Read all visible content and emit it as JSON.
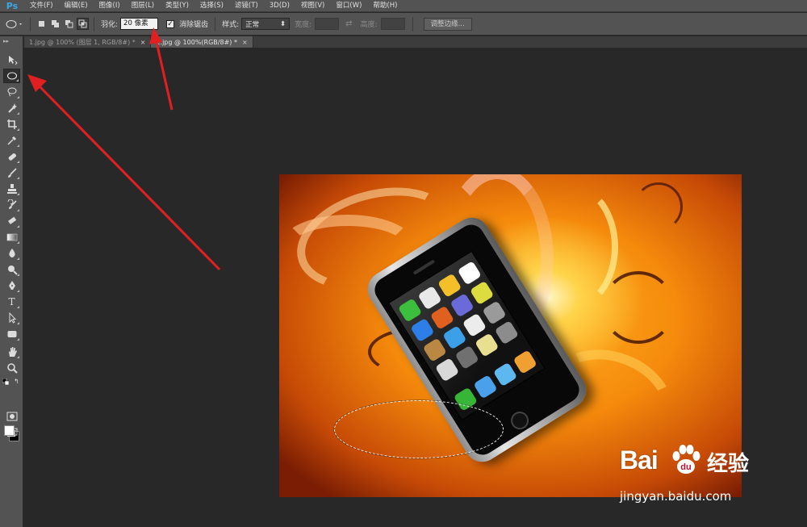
{
  "app": {
    "logo": "Ps"
  },
  "menu": [
    "文件(F)",
    "编辑(E)",
    "图像(I)",
    "图层(L)",
    "类型(Y)",
    "选择(S)",
    "滤镜(T)",
    "3D(D)",
    "视图(V)",
    "窗口(W)",
    "帮助(H)"
  ],
  "options": {
    "feather_label": "羽化:",
    "feather_value": "20 像素",
    "antialias_label": "消除锯齿",
    "antialias_checked": "✓",
    "style_label": "样式:",
    "style_value": "正常",
    "width_label": "宽度:",
    "height_label": "高度:",
    "refine_button": "调整边缘..."
  },
  "tabs": [
    {
      "title": "1.jpg @ 100% (图层 1, RGB/8#) *",
      "close": "×",
      "active": false
    },
    {
      "title": "2.jpg @ 100%(RGB/8#) *",
      "close": "×",
      "active": true
    }
  ],
  "tools": {
    "type_glyph": "T"
  },
  "colors": {
    "foreground": "#ffffff",
    "background": "#000000",
    "arrow": "#e02020",
    "ps_blue": "#3ba8e8"
  },
  "watermark": {
    "logo_left": "Bai",
    "logo_right": "经验",
    "url": "jingyan.baidu.com"
  }
}
